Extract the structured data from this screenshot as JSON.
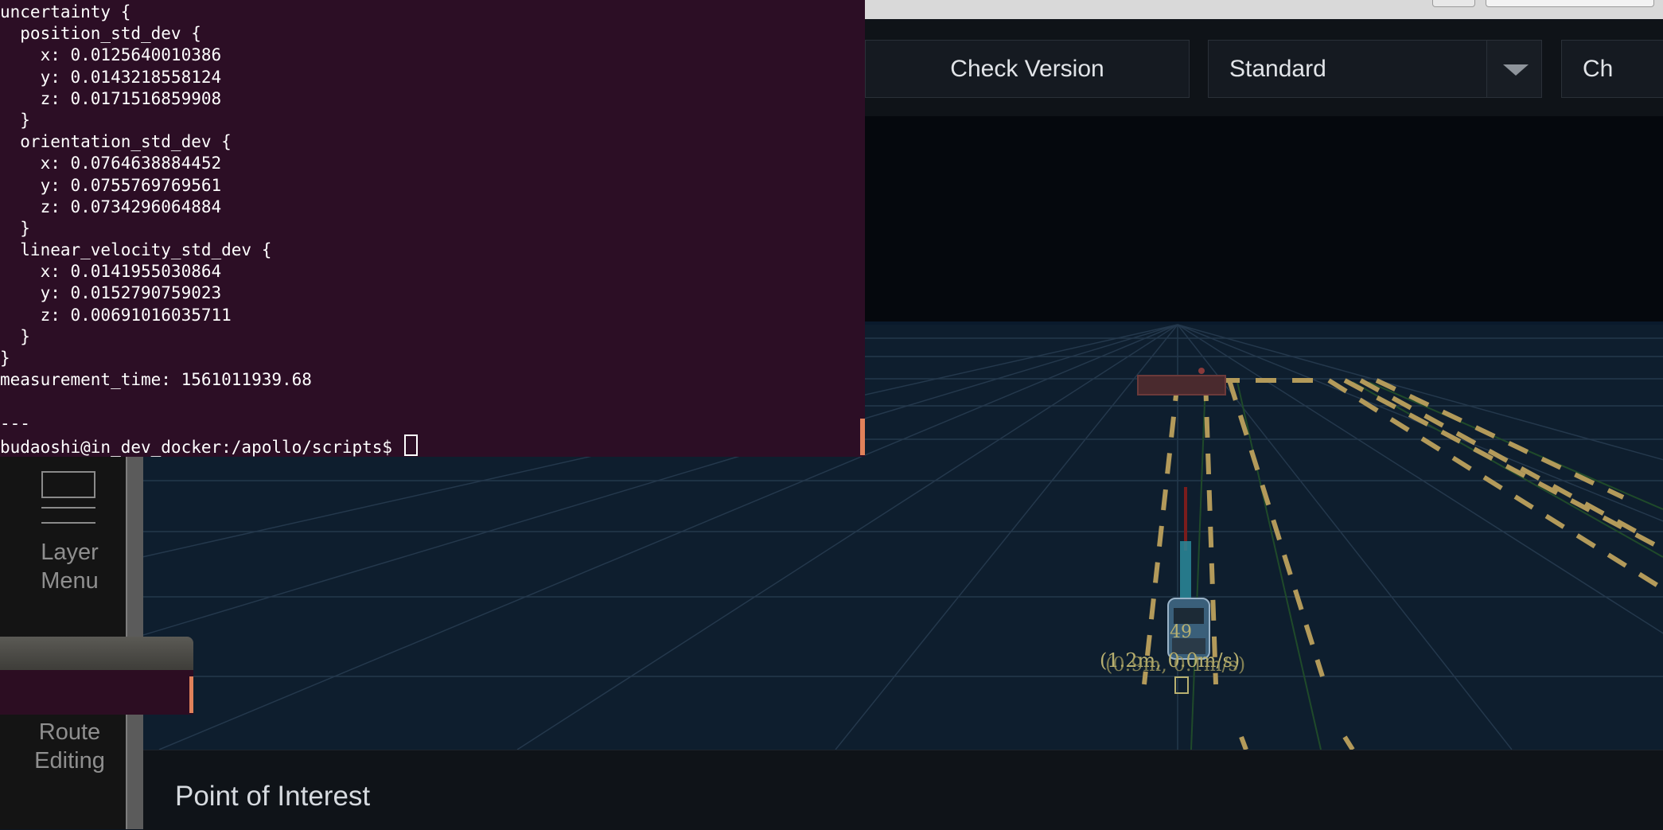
{
  "terminal": {
    "lines": [
      "uncertainty {",
      "  position_std_dev {",
      "    x: 0.0125640010386",
      "    y: 0.0143218558124",
      "    z: 0.0171516859908",
      "  }",
      "  orientation_std_dev {",
      "    x: 0.0764638884452",
      "    y: 0.0755769769561",
      "    z: 0.0734296064884",
      "  }",
      "  linear_velocity_std_dev {",
      "    x: 0.0141955030864",
      "    y: 0.0152790759023",
      "    z: 0.00691016035711",
      "  }",
      "}",
      "measurement_time: 1561011939.68",
      "",
      "---"
    ],
    "prompt": "budaoshi@in_dev_docker:/apollo/scripts$ "
  },
  "header": {
    "check_version_label": "Check Version",
    "mode_select_value": "Standard",
    "partial_button_label": "Ch"
  },
  "sidebar": {
    "layer_menu_label_1": "Layer",
    "layer_menu_label_2": "Menu",
    "route_editing_label_1": "Route",
    "route_editing_label_2": "Editing"
  },
  "scene": {
    "obstacle_id": "49",
    "obstacle_info": "(1.2m, 0.0m/s)",
    "obstacle_info_overlap": "(0.9m, 0.1m/s)"
  },
  "bottom": {
    "poi_label": "Point of Interest"
  },
  "colors": {
    "terminal_bg": "#2c0e25",
    "lane_yellow": "#b39a5a",
    "scene_bg": "#0c1622",
    "accent_orange": "#e0815a"
  }
}
